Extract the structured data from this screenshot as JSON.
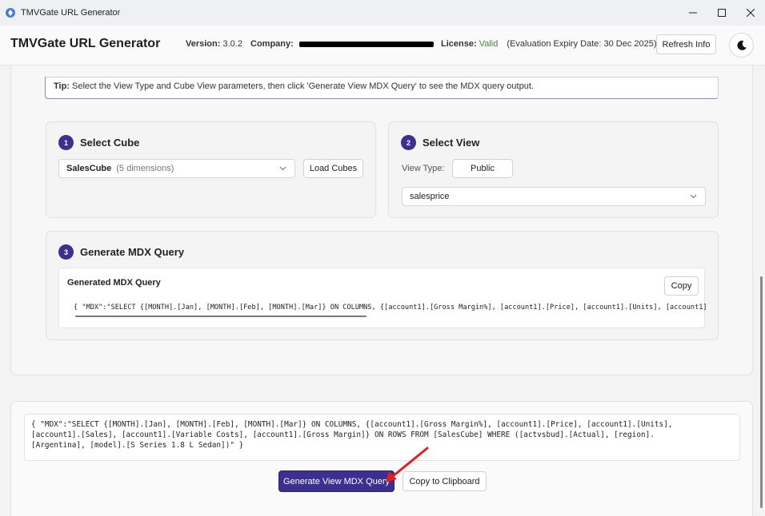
{
  "window": {
    "title": "TMVGate URL Generator",
    "controls": [
      "–",
      "☐",
      "✕"
    ]
  },
  "header": {
    "app_title": "TMVGate URL Generator",
    "version_label": "Version:",
    "version_value": "3.0.2",
    "company_label": "Company:",
    "license_label": "License:",
    "license_status": "Valid",
    "license_expiry": "(Evaluation Expiry Date: 30 Dec 2025)",
    "refresh_label": "Refresh Info",
    "theme_icon": "moon-icon"
  },
  "tip": {
    "prefix": "Tip:",
    "text": "Select the View Type and Cube View parameters, then click 'Generate View MDX Query' to see the MDX query output."
  },
  "step1": {
    "num": "1",
    "title": "Select Cube",
    "cube_name": "SalesCube",
    "cube_dims": "(5 dimensions)",
    "load_label": "Load Cubes"
  },
  "step2": {
    "num": "2",
    "title": "Select View",
    "view_type_label": "View Type:",
    "view_type_value": "Public",
    "view_name": "salesprice"
  },
  "step3": {
    "num": "3",
    "title": "Generate MDX Query",
    "box_label": "Generated MDX Query",
    "copy_label": "Copy",
    "code_line": "{ \"MDX\":\"SELECT {[MONTH].[Jan], [MONTH].[Feb], [MONTH].[Mar]} ON COLUMNS, {[account1].[Gross Margin%], [account1].[Price], [account1].[Units], [account1].["
  },
  "output": {
    "text": "{ \"MDX\":\"SELECT {[MONTH].[Jan], [MONTH].[Feb], [MONTH].[Mar]} ON COLUMNS, {[account1].[Gross Margin%], [account1].[Price], [account1].[Units],\n[account1].[Sales], [account1].[Variable Costs], [account1].[Gross Margin]} ON ROWS FROM [SalesCube] WHERE ([actvsbud].[Actual], [region].\n[Argentina], [model].[S Series 1.8 L Sedan])\" }",
    "generate_label": "Generate View MDX Query",
    "clipboard_label": "Copy to Clipboard"
  },
  "colors": {
    "accent": "#3b2f8f",
    "valid": "#3a8a3a",
    "arrow": "#e02020"
  }
}
